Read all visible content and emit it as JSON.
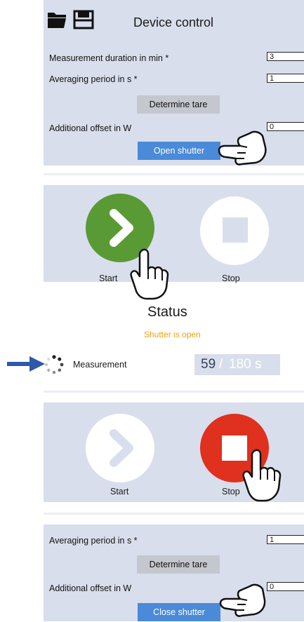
{
  "device_control": {
    "title": "Device control",
    "duration_label": "Measurement duration in min *",
    "duration_value": "3",
    "averaging_label": "Averaging period in s *",
    "averaging_value": "1",
    "tare_button": "Determine tare",
    "offset_label": "Additional offset in W",
    "offset_value": "0",
    "open_shutter_button": "Open shutter"
  },
  "controls_top": {
    "start_label": "Start",
    "stop_label": "Stop"
  },
  "status": {
    "heading": "Status",
    "shutter_state": "Shutter is open",
    "measurement_label": "Measurement",
    "elapsed": "59",
    "separator": "/",
    "total": "180 s"
  },
  "controls_bottom": {
    "start_label": "Start",
    "stop_label": "Stop"
  },
  "device_control_bottom": {
    "averaging_label": "Averaging period in s *",
    "averaging_value": "1",
    "tare_button": "Determine tare",
    "offset_label": "Additional offset in W",
    "offset_value": "0",
    "close_shutter_button": "Close shutter"
  },
  "colors": {
    "panel": "#d9deec",
    "start_active": "#5a9a34",
    "stop_active": "#e0301e",
    "accent_blue": "#4a8ad8",
    "status_orange": "#f0a010",
    "arrow_blue": "#2d5aa8"
  },
  "icons": {
    "folder": "folder-icon",
    "save": "save-icon",
    "pointer": "hand-pointer-icon",
    "spinner": "loading-spinner-icon",
    "arrow": "arrow-right-icon"
  }
}
